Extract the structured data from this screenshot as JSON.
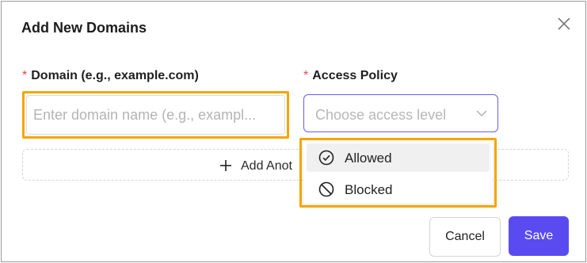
{
  "dialog": {
    "title": "Add New Domains",
    "close_icon": "close-icon"
  },
  "form": {
    "domain": {
      "required_mark": "*",
      "label": "Domain (e.g., example.com)",
      "placeholder": "Enter domain name (e.g., exampl..."
    },
    "policy": {
      "required_mark": "*",
      "label": "Access Policy",
      "placeholder": "Choose access level",
      "chevron_icon": "chevron-down-icon"
    },
    "add_another": {
      "icon": "plus-icon",
      "label": "Add Anot"
    }
  },
  "dropdown": {
    "options": [
      {
        "label": "Allowed",
        "icon": "check-circle-icon",
        "highlighted": true
      },
      {
        "label": "Blocked",
        "icon": "blocked-icon",
        "highlighted": false
      }
    ]
  },
  "footer": {
    "cancel_label": "Cancel",
    "save_label": "Save"
  },
  "colors": {
    "accent": "#5a4bf0",
    "select_border": "#6b5cf5",
    "highlight": "#f5a500",
    "required": "#e5484d"
  }
}
